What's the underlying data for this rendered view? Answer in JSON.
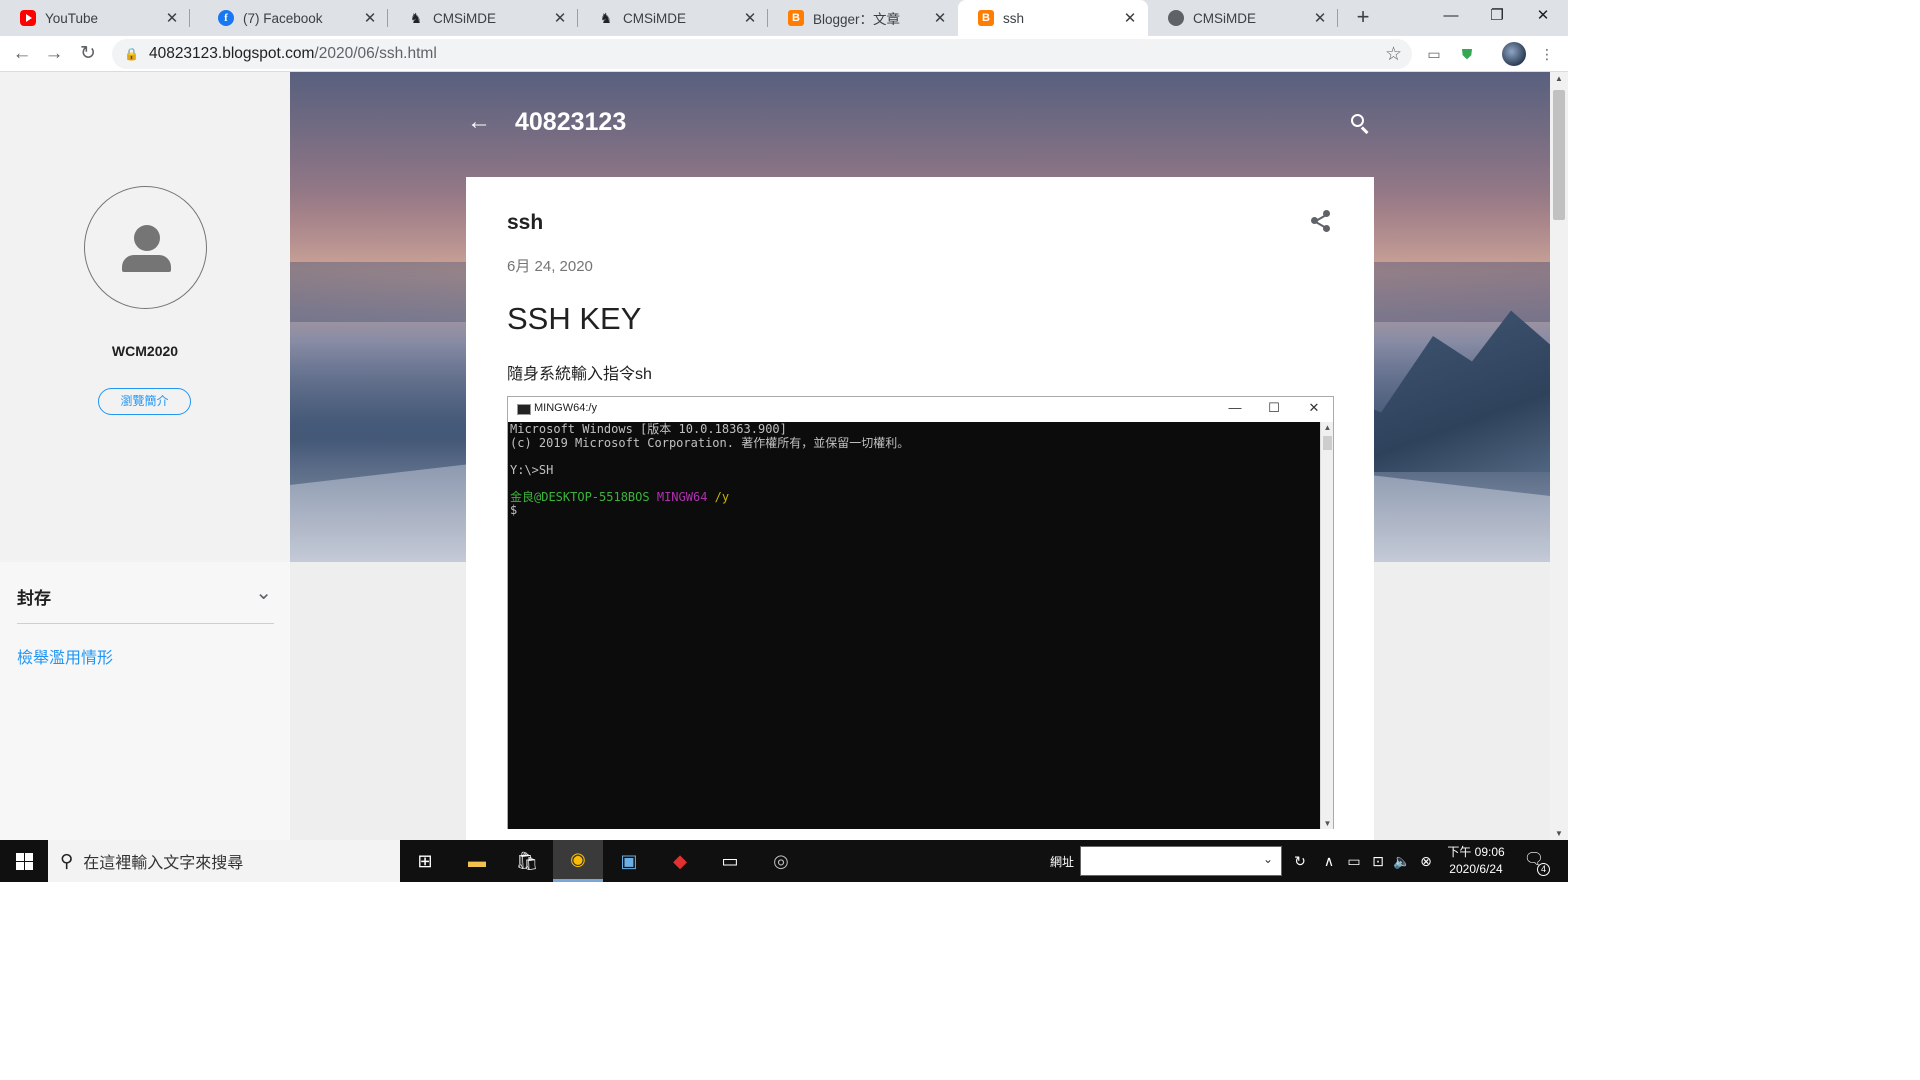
{
  "browser": {
    "tabs": [
      {
        "title": "YouTube",
        "icon": "youtube-icon",
        "active": false
      },
      {
        "title": "(7) Facebook",
        "icon": "facebook-icon",
        "active": false
      },
      {
        "title": "CMSiMDE",
        "icon": "cmsimde-icon",
        "active": false
      },
      {
        "title": "CMSiMDE",
        "icon": "cmsimde-icon",
        "active": false
      },
      {
        "title": "Blogger：文章",
        "icon": "blogger-icon",
        "active": false
      },
      {
        "title": "ssh",
        "icon": "blogger-icon",
        "active": true
      },
      {
        "title": "CMSiMDE",
        "icon": "globe-icon",
        "active": false
      }
    ],
    "url_host": "40823123.blogspot.com",
    "url_path": "/2020/06/ssh.html"
  },
  "blog": {
    "title": "40823123",
    "profile_name": "WCM2020",
    "profile_button": "瀏覽簡介",
    "archive_label": "封存",
    "report_abuse": "檢舉濫用情形"
  },
  "post": {
    "title": "ssh",
    "date": "6月 24, 2020",
    "heading": "SSH KEY",
    "text": "隨身系統輸入指令sh"
  },
  "terminal": {
    "title": "MINGW64:/y",
    "lines": {
      "l1": "Microsoft Windows [版本 10.0.18363.900]",
      "l2": "(c) 2019 Microsoft Corporation. 著作權所有，並保留一切權利。",
      "l3": "Y:\\>SH",
      "prompt_user": "金良@DESKTOP-5518BOS",
      "prompt_env": "MINGW64",
      "prompt_dir": "/y",
      "prompt_symbol": "$"
    }
  },
  "taskbar": {
    "search_placeholder": "在這裡輸入文字來搜尋",
    "address_label": "網址",
    "clock_time": "下午 09:06",
    "clock_date": "2020/6/24",
    "notification_count": "4"
  }
}
